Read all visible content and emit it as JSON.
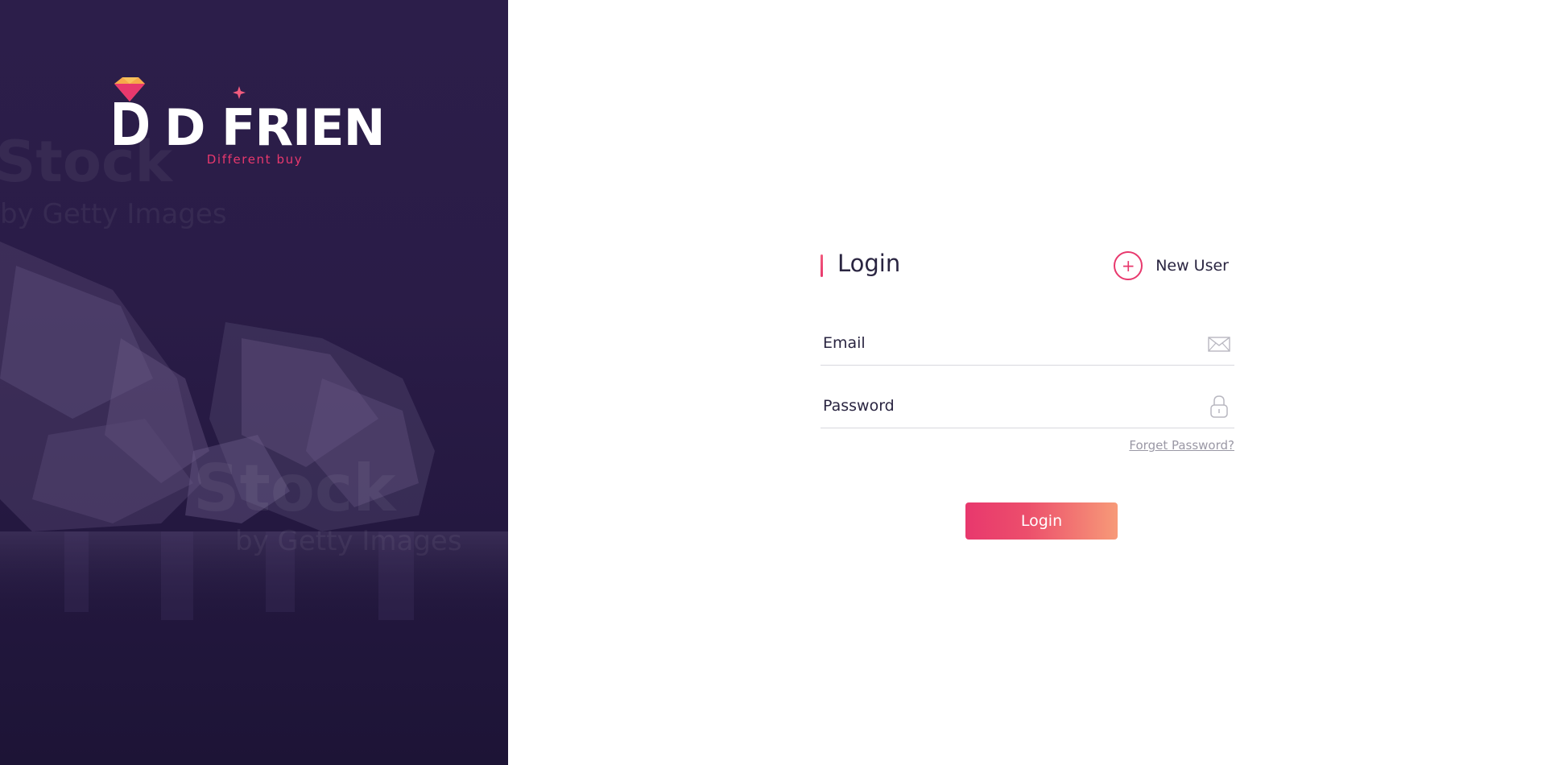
{
  "brand": {
    "name": "D FRIENDS",
    "tagline": "Different buy",
    "watermark": [
      "Stock",
      "by Getty Images"
    ],
    "colors": {
      "accent": "#e8386d",
      "accent_light": "#f79a78",
      "panel": "#2a1c47",
      "text": "#2a2541",
      "muted": "#9a98a5"
    }
  },
  "form": {
    "title": "Login",
    "new_user_label": "New User",
    "new_user_icon": "plus-circle-icon",
    "email": {
      "placeholder": "Email",
      "value": "",
      "icon": "envelope-icon"
    },
    "password": {
      "placeholder": "Password",
      "value": "",
      "icon": "lock-icon"
    },
    "forgot_label": "Forget Password?",
    "submit_label": "Login"
  }
}
